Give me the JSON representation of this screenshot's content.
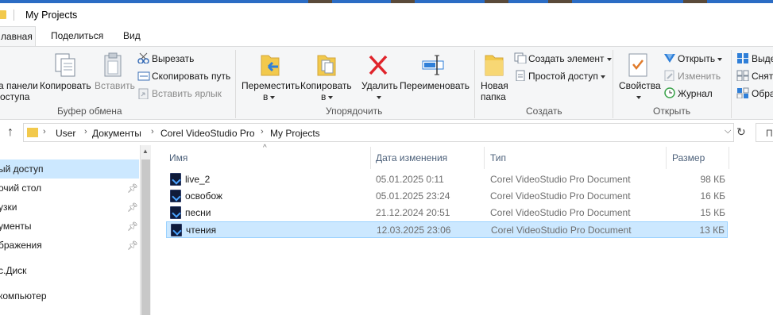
{
  "window": {
    "title": "My Projects"
  },
  "tabs": [
    {
      "label": "Главная",
      "display": "лавная"
    },
    {
      "label": "Поделиться"
    },
    {
      "label": "Вид"
    }
  ],
  "ribbon": {
    "clipboard": {
      "pin_label_1": "а панели",
      "pin_label_2": "оступа",
      "copy": "Копировать",
      "paste": "Вставить",
      "cut": "Вырезать",
      "copy_path": "Скопировать путь",
      "paste_shortcut": "Вставить ярлык",
      "group": "Буфер обмена"
    },
    "organize": {
      "move_1": "Переместить",
      "move_2": "в",
      "copy_1": "Копировать",
      "copy_2": "в",
      "delete": "Удалить",
      "rename": "Переименовать",
      "group": "Упорядочить"
    },
    "new": {
      "new_folder_1": "Новая",
      "new_folder_2": "папка",
      "new_item": "Создать элемент",
      "easy_access": "Простой доступ",
      "group": "Создать"
    },
    "open": {
      "properties": "Свойства",
      "open": "Открыть",
      "edit": "Изменить",
      "history": "Журнал",
      "group": "Открыть"
    },
    "select": {
      "select_all": "Выде",
      "select_none": "Снят",
      "invert": "Обра"
    }
  },
  "address": {
    "crumbs": [
      "User",
      "Документы",
      "Corel VideoStudio Pro",
      "My Projects"
    ],
    "search_placeholder": "П"
  },
  "sidebar": {
    "items": [
      {
        "label": "ый доступ",
        "pinned": false
      },
      {
        "label": "очий стол",
        "pinned": true
      },
      {
        "label": "узки",
        "pinned": true
      },
      {
        "label": "ументы",
        "pinned": true
      },
      {
        "label": "бражения",
        "pinned": true
      },
      {
        "label": "с.Диск",
        "pinned": false
      },
      {
        "label": "компьютер",
        "pinned": false
      }
    ]
  },
  "columns": {
    "name": "Имя",
    "date": "Дата изменения",
    "type": "Тип",
    "size": "Размер"
  },
  "files": [
    {
      "name": "live_2",
      "date": "05.01.2025 0:11",
      "type": "Corel VideoStudio Pro Document",
      "size": "98 КБ",
      "selected": false
    },
    {
      "name": "освобож",
      "date": "05.01.2025 23:24",
      "type": "Corel VideoStudio Pro Document",
      "size": "16 КБ",
      "selected": false
    },
    {
      "name": "песни",
      "date": "21.12.2024 20:51",
      "type": "Corel VideoStudio Pro Document",
      "size": "15 КБ",
      "selected": false
    },
    {
      "name": "чтения",
      "date": "12.03.2025 23:06",
      "type": "Corel VideoStudio Pro Document",
      "size": "13 КБ",
      "selected": true
    }
  ],
  "colors": {
    "selection": "#cce8ff",
    "selection_border": "#99d1ff",
    "ribbon_bg": "#f5f6f7",
    "delete_red": "#e0242b",
    "folder_yellow": "#f2c94c"
  }
}
